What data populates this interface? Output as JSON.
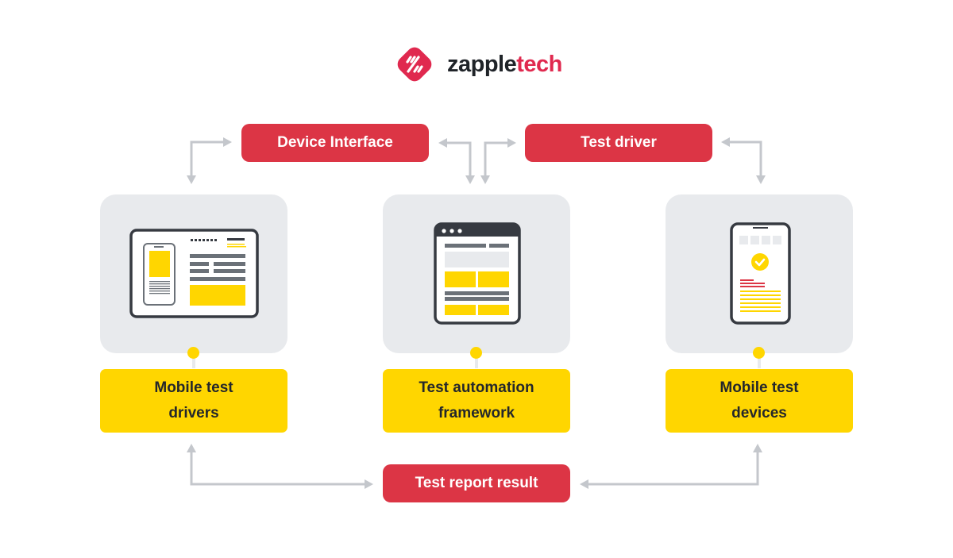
{
  "logo": {
    "name_part1": "zapple",
    "name_part2": "tech",
    "icon": "zappletech-logo-icon",
    "brand_color": "#e0294f"
  },
  "top_boxes": {
    "device_interface": "Device Interface",
    "test_driver": "Test driver"
  },
  "nodes": [
    {
      "label_line1": "Mobile test",
      "label_line2": "drivers",
      "icon": "tablet-with-phone-icon"
    },
    {
      "label_line1": "Test automation",
      "label_line2": "framework",
      "icon": "browser-window-icon"
    },
    {
      "label_line1": "Mobile test",
      "label_line2": "devices",
      "icon": "smartphone-check-icon"
    }
  ],
  "bottom_box": {
    "label": "Test report result"
  },
  "colors": {
    "red": "#dc3545",
    "yellow": "#ffd600",
    "card_gray": "#e8eaed",
    "arrow_gray": "#c4c7cc",
    "dark": "#363a41"
  }
}
